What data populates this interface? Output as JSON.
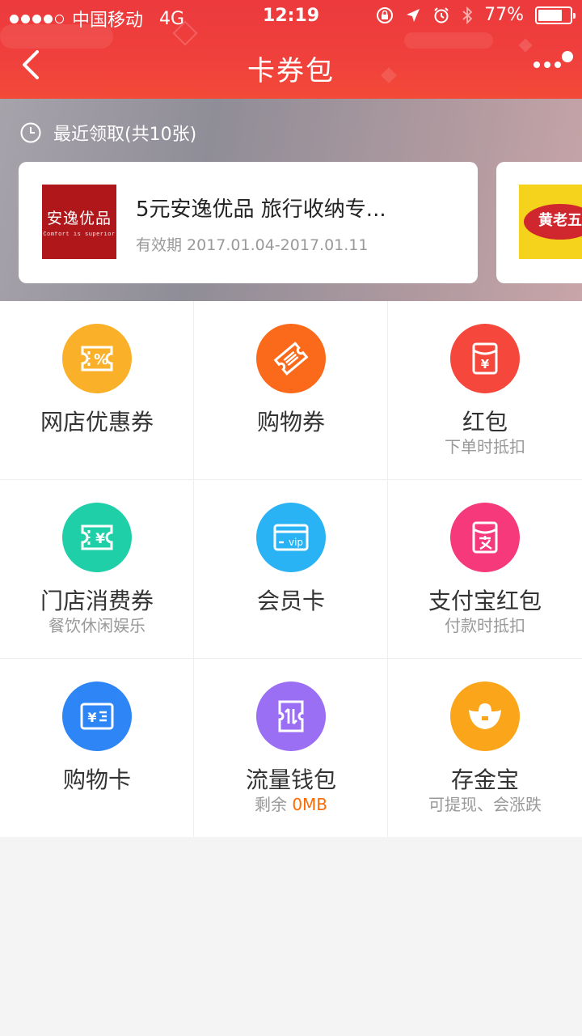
{
  "status_bar": {
    "carrier": "中国移动",
    "network": "4G",
    "time": "12:19",
    "battery": "77%",
    "battery_level": 0.77
  },
  "nav": {
    "title": "卡券包"
  },
  "recent": {
    "heading": "最近领取(共10张)",
    "cards": [
      {
        "logo_text": "安逸优品",
        "logo_subtext": "Comfort is superior",
        "title": "5元安逸优品 旅行收纳专...",
        "validity": "有效期 2017.01.04-2017.01.11"
      },
      {
        "logo_text": "黄老五"
      }
    ]
  },
  "grid": [
    {
      "label": "网店优惠券",
      "sub": "",
      "icon": "percent-ticket-icon",
      "color": "#fbb02a"
    },
    {
      "label": "购物券",
      "sub": "",
      "icon": "ticket-icon",
      "color": "#fb6a1b"
    },
    {
      "label": "红包",
      "sub": "下单时抵扣",
      "icon": "red-envelope-icon",
      "color": "#f5473b"
    },
    {
      "label": "门店消费券",
      "sub": "餐饮休闲娱乐",
      "icon": "yuan-ticket-icon",
      "color": "#1fcfa8"
    },
    {
      "label": "会员卡",
      "sub": "",
      "icon": "vip-card-icon",
      "color": "#29b3f4"
    },
    {
      "label": "支付宝红包",
      "sub": "付款时抵扣",
      "icon": "alipay-envelope-icon",
      "color": "#f5397b"
    },
    {
      "label": "购物卡",
      "sub": "",
      "icon": "shopping-card-icon",
      "color": "#2e86f6"
    },
    {
      "label": "流量钱包",
      "sub_prefix": "剩余 ",
      "sub_highlight": "0MB",
      "icon": "data-wallet-icon",
      "color": "#9b6ff4"
    },
    {
      "label": "存金宝",
      "sub": "可提现、会涨跌",
      "icon": "gold-ingot-icon",
      "color": "#fba51a"
    }
  ]
}
